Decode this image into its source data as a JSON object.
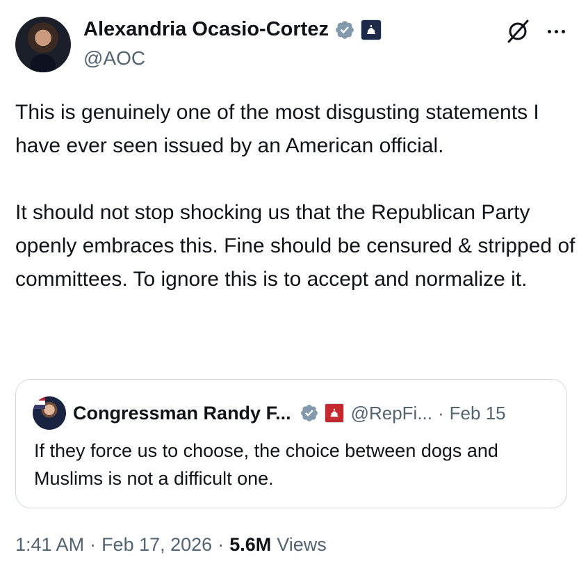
{
  "author": {
    "display_name": "Alexandria Ocasio-Cortez",
    "handle": "@AOC"
  },
  "tweet": {
    "paragraphs": [
      "This is genuinely one of the most disgusting statements I have ever seen issued by an American official.",
      "It should not stop shocking us that the Republican Party openly embraces this. Fine should be censured & stripped of committees. To ignore this is to accept and normalize it."
    ]
  },
  "quoted_tweet": {
    "display_name": "Congressman Randy F...",
    "handle": "@RepFi...",
    "separator": "·",
    "date": "Feb 15",
    "text": "If they force us to choose, the choice between dogs and Muslims is not a difficult one."
  },
  "meta": {
    "time": "1:41 AM",
    "separator1": "·",
    "date": "Feb 17, 2026",
    "separator2": "·",
    "views_count": "5.6M",
    "views_label": "Views"
  },
  "icons": {
    "verified": "verified-badge-icon",
    "government": "capitol-badge-icon",
    "grok": "grok-icon",
    "more": "more-icon"
  },
  "colors": {
    "text": "#0f1419",
    "secondary": "#536471",
    "verified": "#829aab",
    "border": "#cfd9de",
    "gov_badge": "#1d2a4a",
    "party_badge": "#c5282f"
  }
}
